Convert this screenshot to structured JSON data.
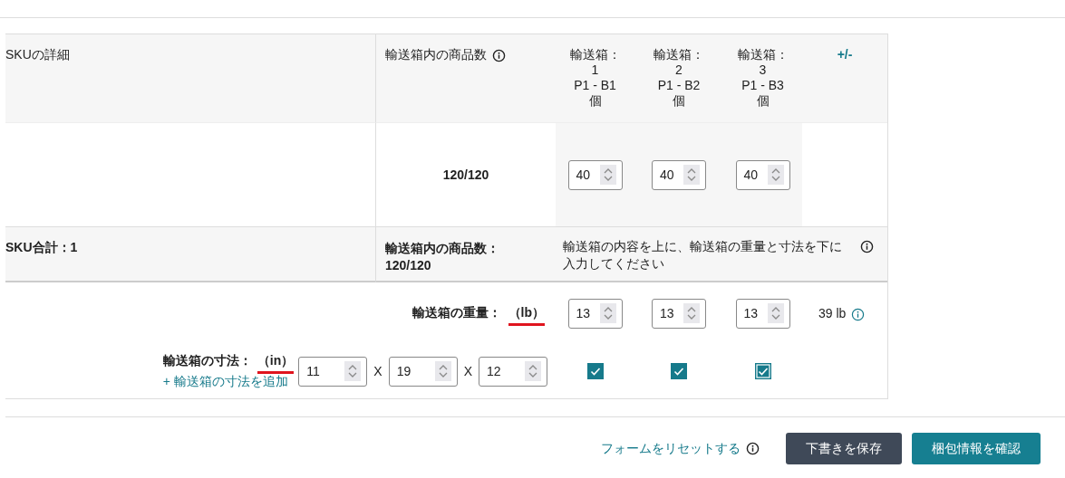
{
  "header": {
    "sku_details": "SKUの詳細",
    "units_in_box": "輸送箱内の商品数",
    "add_remove": "+/-",
    "boxes": [
      {
        "lines": [
          "輸送箱：",
          "1",
          "P1 - B1",
          "個"
        ]
      },
      {
        "lines": [
          "輸送箱：",
          "2",
          "P1 - B2",
          "個"
        ]
      },
      {
        "lines": [
          "輸送箱：",
          "3",
          "P1 - B3",
          "個"
        ]
      }
    ]
  },
  "sku_row": {
    "total": "120/120",
    "quantities": [
      "40",
      "40",
      "40"
    ]
  },
  "summary": {
    "sku_total": "SKU合計：1",
    "units_label": "輸送箱内の商品数：",
    "units_value": "120/120",
    "instruction": "輸送箱の内容を上に、輸送箱の重量と寸法を下に入力してください"
  },
  "weight": {
    "label": "輸送箱の重量：",
    "unit": "（lb）",
    "values": [
      "13",
      "13",
      "13"
    ],
    "total": "39 lb"
  },
  "dimensions": {
    "label": "輸送箱の寸法：",
    "unit": "（in）",
    "add_link": "+ 輸送箱の寸法を追加",
    "values": [
      "11",
      "19",
      "12"
    ],
    "separators": [
      "X",
      "X"
    ],
    "boxes": [
      {
        "checked": true,
        "focused": false
      },
      {
        "checked": true,
        "focused": false
      },
      {
        "checked": true,
        "focused": true
      }
    ]
  },
  "footer": {
    "reset_link": "フォームをリセットする",
    "buttons": [
      {
        "label": "下書きを保存",
        "kind": "secondary"
      },
      {
        "label": "梱包情報を確認",
        "kind": "primary"
      }
    ]
  }
}
